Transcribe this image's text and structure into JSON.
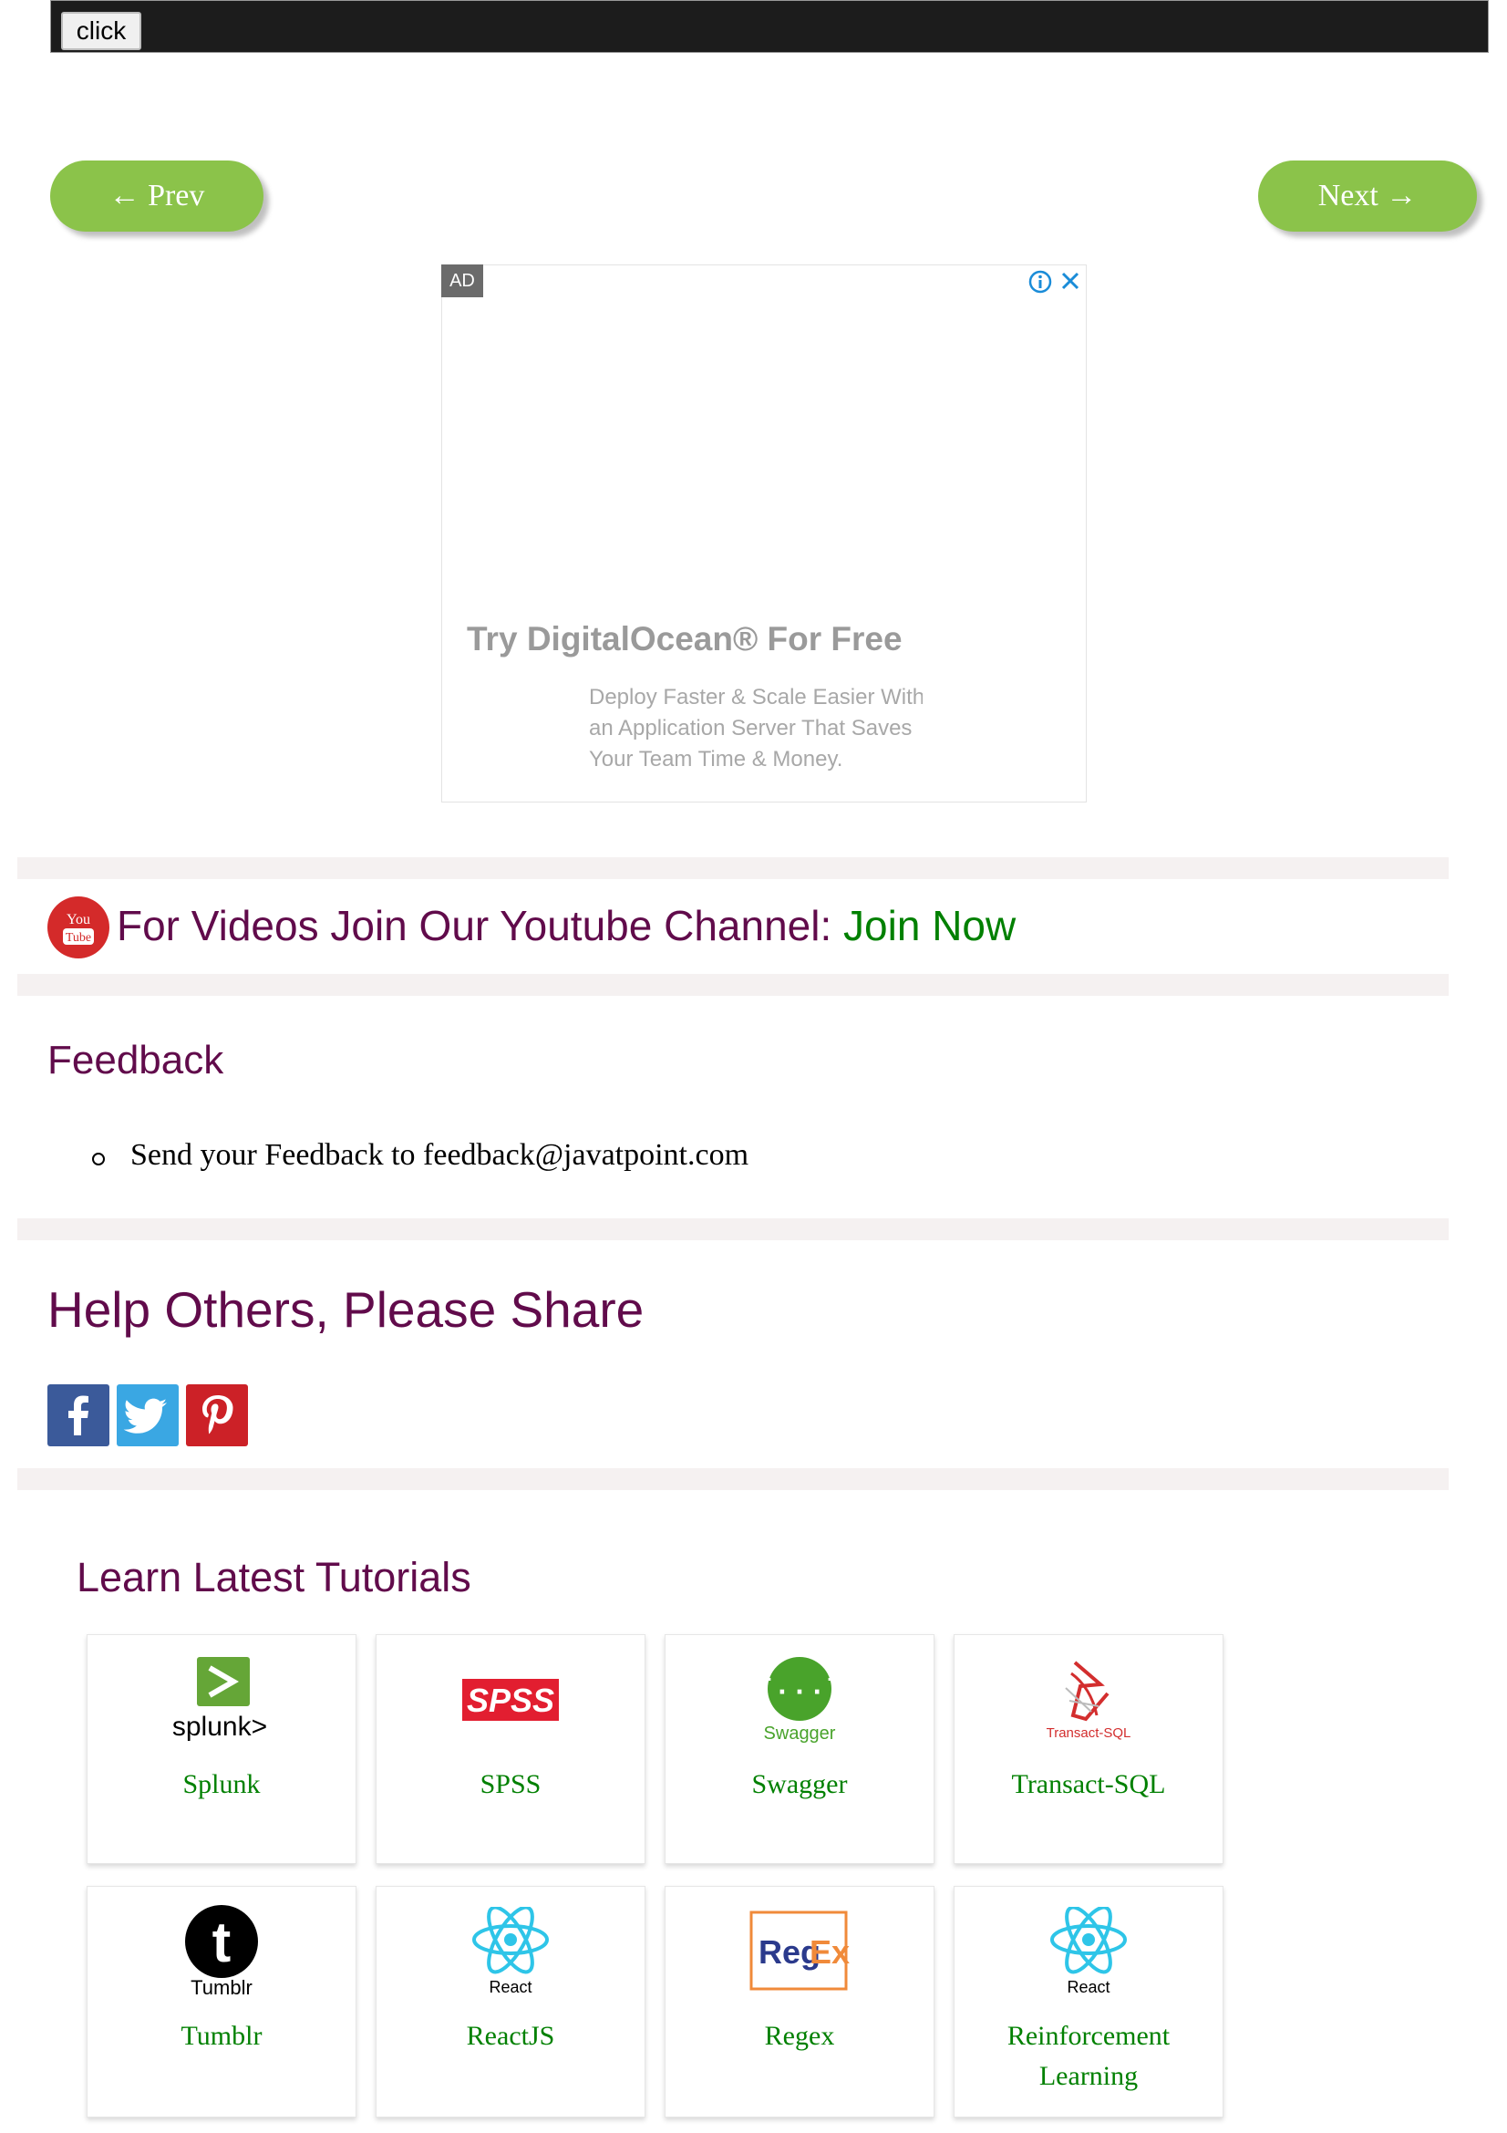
{
  "topbar": {
    "button_label": "click"
  },
  "nav": {
    "prev_label": "← Prev",
    "next_label": "Next →"
  },
  "ad": {
    "badge": "AD",
    "headline": "Try DigitalOcean® For Free",
    "body_lines": [
      "Deploy Faster & Scale Easier With",
      "an Application Server That Saves",
      "Your Team Time & Money."
    ]
  },
  "youtube": {
    "icon_text_top": "You",
    "icon_text_bottom": "Tube",
    "text": "For Videos Join Our Youtube Channel: ",
    "link": "Join Now"
  },
  "feedback": {
    "heading": "Feedback",
    "item": "Send your Feedback to feedback@javatpoint.com"
  },
  "share": {
    "heading": "Help Others, Please Share",
    "buttons": [
      "facebook",
      "twitter",
      "pinterest"
    ]
  },
  "tutorials": {
    "heading": "Learn Latest Tutorials",
    "cards": [
      {
        "label": "Splunk",
        "logo_text": "splunk>",
        "icon": "splunk-icon"
      },
      {
        "label": "SPSS",
        "logo_text": "SPSS",
        "icon": "spss-icon"
      },
      {
        "label": "Swagger",
        "logo_text": "Swagger",
        "icon": "swagger-icon"
      },
      {
        "label": "Transact-SQL",
        "logo_text": "Transact-SQL",
        "icon": "transact-sql-icon"
      },
      {
        "label": "Tumblr",
        "logo_text": "Tumblr",
        "icon": "tumblr-icon"
      },
      {
        "label": "ReactJS",
        "logo_text": "React",
        "icon": "react-icon"
      },
      {
        "label": "Regex",
        "logo_text_a": "Reg",
        "logo_text_b": "Ex",
        "icon": "regex-icon"
      },
      {
        "label_line1": "Reinforcement",
        "label_line2": "Learning",
        "logo_text": "React",
        "icon": "react-icon"
      }
    ]
  },
  "colors": {
    "heading": "#610b4b",
    "link_green": "#008000",
    "button_green": "#8bc34a",
    "topbar": "#1c1c1c"
  }
}
